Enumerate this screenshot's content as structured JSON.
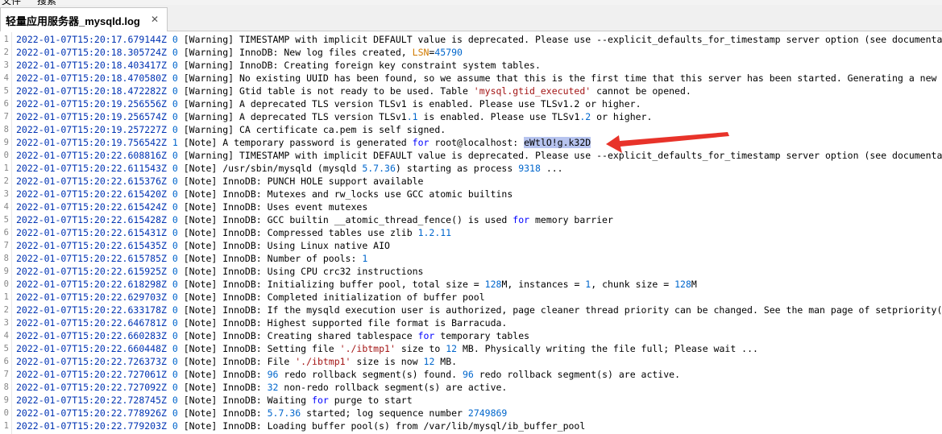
{
  "menubar": {
    "file": "文件",
    "search": "搜索"
  },
  "tab": {
    "title": "轻量应用服务器_mysqld.log",
    "close_glyph": "✕"
  },
  "gutter_numbers": [
    "1",
    "2",
    "3",
    "4",
    "5",
    "6",
    "7",
    "8",
    "9",
    "0",
    "1",
    "2",
    "3",
    "4",
    "5",
    "6",
    "7",
    "8",
    "9",
    "0",
    "1",
    "2",
    "3",
    "4",
    "5",
    "6",
    "7",
    "8",
    "9",
    "0",
    "1"
  ],
  "lines": [
    {
      "ts": "2022-01-07T15:20:17.679144Z",
      "id": "0",
      "level": "[Warning]",
      "segments": [
        {
          "t": "TIMESTAMP with implicit DEFAULT value is deprecated. Please use --explicit_defaults_for_timestamp server option (see documentation for more details)."
        }
      ]
    },
    {
      "ts": "2022-01-07T15:20:18.305724Z",
      "id": "0",
      "level": "[Warning]",
      "segments": [
        {
          "t": "InnoDB: New log files created, "
        },
        {
          "t": "LSN",
          "c": "lsn"
        },
        {
          "t": "="
        },
        {
          "t": "45790",
          "c": "num"
        }
      ]
    },
    {
      "ts": "2022-01-07T15:20:18.403417Z",
      "id": "0",
      "level": "[Warning]",
      "segments": [
        {
          "t": "InnoDB: Creating foreign key constraint system tables."
        }
      ]
    },
    {
      "ts": "2022-01-07T15:20:18.470580Z",
      "id": "0",
      "level": "[Warning]",
      "segments": [
        {
          "t": "No existing UUID has been found, so we assume that this is the first time that this server has been started. Generating a new UUID"
        }
      ]
    },
    {
      "ts": "2022-01-07T15:20:18.472282Z",
      "id": "0",
      "level": "[Warning]",
      "segments": [
        {
          "t": "Gtid table is not ready to be used. Table "
        },
        {
          "t": "'mysql.gtid_executed'",
          "c": "str"
        },
        {
          "t": " cannot be opened."
        }
      ]
    },
    {
      "ts": "2022-01-07T15:20:19.256556Z",
      "id": "0",
      "level": "[Warning]",
      "segments": [
        {
          "t": "A deprecated TLS version TLSv1 is enabled. Please use TLSv1.2 or higher."
        }
      ]
    },
    {
      "ts": "2022-01-07T15:20:19.256574Z",
      "id": "0",
      "level": "[Warning]",
      "segments": [
        {
          "t": "A deprecated TLS version TLSv1"
        },
        {
          "t": ".1",
          "c": "num"
        },
        {
          "t": " is enabled. Please use TLSv1"
        },
        {
          "t": ".2",
          "c": "num"
        },
        {
          "t": " or higher."
        }
      ]
    },
    {
      "ts": "2022-01-07T15:20:19.257227Z",
      "id": "0",
      "level": "[Warning]",
      "segments": [
        {
          "t": "CA certificate ca.pem is self signed."
        }
      ]
    },
    {
      "ts": "2022-01-07T15:20:19.756542Z",
      "id": "1",
      "level": "[Note]",
      "segments": [
        {
          "t": "A temporary password is generated "
        },
        {
          "t": "for",
          "c": "kw"
        },
        {
          "t": " root@localhost: "
        },
        {
          "t": "eWtlO!g.k32D",
          "c": "sel"
        }
      ]
    },
    {
      "ts": "2022-01-07T15:20:22.608816Z",
      "id": "0",
      "level": "[Warning]",
      "segments": [
        {
          "t": "TIMESTAMP with implicit DEFAULT value is deprecated. Please use --explicit_defaults_for_timestamp server option (see documentation for more details)."
        }
      ]
    },
    {
      "ts": "2022-01-07T15:20:22.611543Z",
      "id": "0",
      "level": "[Note]",
      "segments": [
        {
          "t": "/usr/sbin/mysqld (mysqld "
        },
        {
          "t": "5.7.36",
          "c": "num"
        },
        {
          "t": ") starting as process "
        },
        {
          "t": "9318",
          "c": "num"
        },
        {
          "t": " ..."
        }
      ]
    },
    {
      "ts": "2022-01-07T15:20:22.615376Z",
      "id": "0",
      "level": "[Note]",
      "segments": [
        {
          "t": "InnoDB: PUNCH HOLE support available"
        }
      ]
    },
    {
      "ts": "2022-01-07T15:20:22.615420Z",
      "id": "0",
      "level": "[Note]",
      "segments": [
        {
          "t": "InnoDB: Mutexes and rw_locks use GCC atomic builtins"
        }
      ]
    },
    {
      "ts": "2022-01-07T15:20:22.615424Z",
      "id": "0",
      "level": "[Note]",
      "segments": [
        {
          "t": "InnoDB: Uses event mutexes"
        }
      ]
    },
    {
      "ts": "2022-01-07T15:20:22.615428Z",
      "id": "0",
      "level": "[Note]",
      "segments": [
        {
          "t": "InnoDB: GCC builtin __atomic_thread_fence() is used "
        },
        {
          "t": "for",
          "c": "kw"
        },
        {
          "t": " memory barrier"
        }
      ]
    },
    {
      "ts": "2022-01-07T15:20:22.615431Z",
      "id": "0",
      "level": "[Note]",
      "segments": [
        {
          "t": "InnoDB: Compressed tables use zlib "
        },
        {
          "t": "1.2.11",
          "c": "num"
        }
      ]
    },
    {
      "ts": "2022-01-07T15:20:22.615435Z",
      "id": "0",
      "level": "[Note]",
      "segments": [
        {
          "t": "InnoDB: Using Linux native AIO"
        }
      ]
    },
    {
      "ts": "2022-01-07T15:20:22.615785Z",
      "id": "0",
      "level": "[Note]",
      "segments": [
        {
          "t": "InnoDB: Number of pools: "
        },
        {
          "t": "1",
          "c": "num"
        }
      ]
    },
    {
      "ts": "2022-01-07T15:20:22.615925Z",
      "id": "0",
      "level": "[Note]",
      "segments": [
        {
          "t": "InnoDB: Using CPU crc32 instructions"
        }
      ]
    },
    {
      "ts": "2022-01-07T15:20:22.618298Z",
      "id": "0",
      "level": "[Note]",
      "segments": [
        {
          "t": "InnoDB: Initializing buffer pool, total size = "
        },
        {
          "t": "128",
          "c": "num"
        },
        {
          "t": "M, instances = "
        },
        {
          "t": "1",
          "c": "num"
        },
        {
          "t": ", chunk size = "
        },
        {
          "t": "128",
          "c": "num"
        },
        {
          "t": "M"
        }
      ]
    },
    {
      "ts": "2022-01-07T15:20:22.629703Z",
      "id": "0",
      "level": "[Note]",
      "segments": [
        {
          "t": "InnoDB: Completed initialization of buffer pool"
        }
      ]
    },
    {
      "ts": "2022-01-07T15:20:22.633178Z",
      "id": "0",
      "level": "[Note]",
      "segments": [
        {
          "t": "InnoDB: If the mysqld execution user is authorized, page cleaner thread priority can be changed. See the man page of setpriority()."
        }
      ]
    },
    {
      "ts": "2022-01-07T15:20:22.646781Z",
      "id": "0",
      "level": "[Note]",
      "segments": [
        {
          "t": "InnoDB: Highest supported file format is Barracuda."
        }
      ]
    },
    {
      "ts": "2022-01-07T15:20:22.660283Z",
      "id": "0",
      "level": "[Note]",
      "segments": [
        {
          "t": "InnoDB: Creating shared tablespace "
        },
        {
          "t": "for",
          "c": "kw"
        },
        {
          "t": " temporary tables"
        }
      ]
    },
    {
      "ts": "2022-01-07T15:20:22.660448Z",
      "id": "0",
      "level": "[Note]",
      "segments": [
        {
          "t": "InnoDB: Setting file "
        },
        {
          "t": "'./ibtmp1'",
          "c": "str"
        },
        {
          "t": " size to "
        },
        {
          "t": "12",
          "c": "num"
        },
        {
          "t": " MB. Physically writing the file full; Please wait ..."
        }
      ]
    },
    {
      "ts": "2022-01-07T15:20:22.726373Z",
      "id": "0",
      "level": "[Note]",
      "segments": [
        {
          "t": "InnoDB: File "
        },
        {
          "t": "'./ibtmp1'",
          "c": "str"
        },
        {
          "t": " size is now "
        },
        {
          "t": "12",
          "c": "num"
        },
        {
          "t": " MB."
        }
      ]
    },
    {
      "ts": "2022-01-07T15:20:22.727061Z",
      "id": "0",
      "level": "[Note]",
      "segments": [
        {
          "t": "InnoDB: "
        },
        {
          "t": "96",
          "c": "num"
        },
        {
          "t": " redo rollback segment(s) found. "
        },
        {
          "t": "96",
          "c": "num"
        },
        {
          "t": " redo rollback segment(s) are active."
        }
      ]
    },
    {
      "ts": "2022-01-07T15:20:22.727092Z",
      "id": "0",
      "level": "[Note]",
      "segments": [
        {
          "t": "InnoDB: "
        },
        {
          "t": "32",
          "c": "num"
        },
        {
          "t": " non-redo rollback segment(s) are active."
        }
      ]
    },
    {
      "ts": "2022-01-07T15:20:22.728745Z",
      "id": "0",
      "level": "[Note]",
      "segments": [
        {
          "t": "InnoDB: Waiting "
        },
        {
          "t": "for",
          "c": "kw"
        },
        {
          "t": " purge to start"
        }
      ]
    },
    {
      "ts": "2022-01-07T15:20:22.778926Z",
      "id": "0",
      "level": "[Note]",
      "segments": [
        {
          "t": "InnoDB: "
        },
        {
          "t": "5.7.36",
          "c": "num"
        },
        {
          "t": " started; log sequence number "
        },
        {
          "t": "2749869",
          "c": "num"
        }
      ]
    },
    {
      "ts": "2022-01-07T15:20:22.779203Z",
      "id": "0",
      "level": "[Note]",
      "segments": [
        {
          "t": "InnoDB: Loading buffer pool(s) from /var/lib/mysql/ib_buffer_pool"
        }
      ]
    }
  ],
  "colors": {
    "timestamp": "#0033b3",
    "number": "#0066cc",
    "keyword": "#0000ff",
    "string": "#a31515",
    "lsn": "#d07a00",
    "selection": "#b7c4ef",
    "arrow": "#e8332a"
  }
}
